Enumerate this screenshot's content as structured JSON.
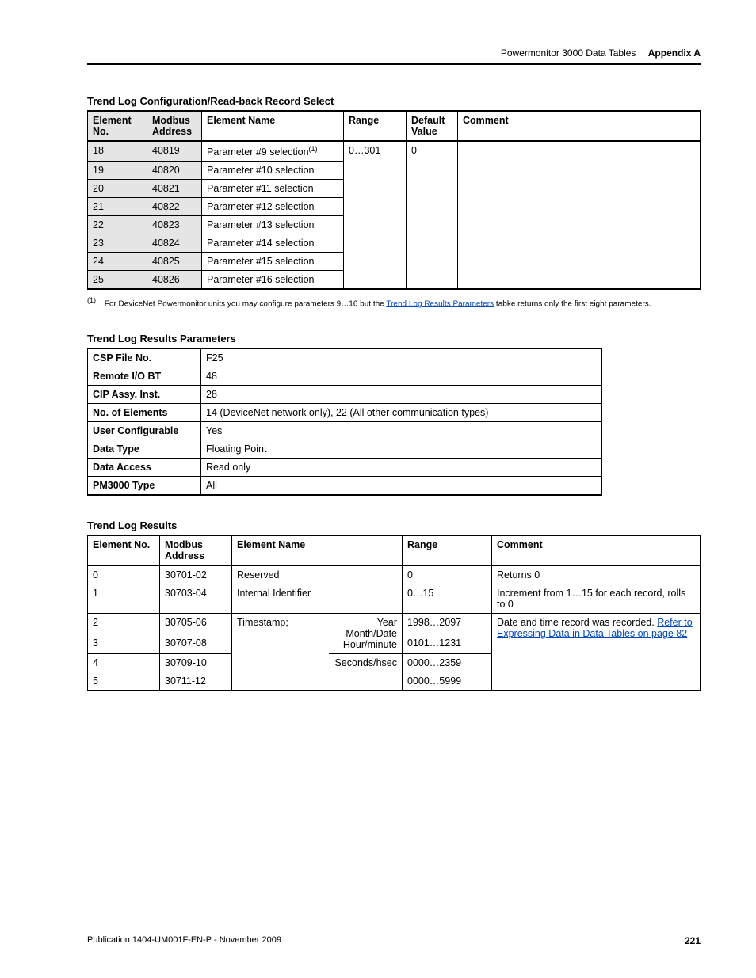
{
  "header": {
    "section": "Powermonitor 3000 Data Tables",
    "appendix": "Appendix A"
  },
  "table1": {
    "title": "Trend Log Configuration/Read-back Record Select",
    "headers": {
      "element_no": "Element No.",
      "modbus": "Modbus Address",
      "name": "Element Name",
      "range": "Range",
      "default": "Default Value",
      "comment": "Comment"
    },
    "range_val": "0…301",
    "default_val": "0",
    "rows": [
      {
        "no": "18",
        "mb": "40819",
        "name": "Parameter #9 selection",
        "sup": "(1)"
      },
      {
        "no": "19",
        "mb": "40820",
        "name": "Parameter #10 selection"
      },
      {
        "no": "20",
        "mb": "40821",
        "name": "Parameter #11 selection"
      },
      {
        "no": "21",
        "mb": "40822",
        "name": "Parameter #12 selection"
      },
      {
        "no": "22",
        "mb": "40823",
        "name": "Parameter #13 selection"
      },
      {
        "no": "23",
        "mb": "40824",
        "name": "Parameter #14 selection"
      },
      {
        "no": "24",
        "mb": "40825",
        "name": "Parameter #15 selection"
      },
      {
        "no": "25",
        "mb": "40826",
        "name": "Parameter #16 selection"
      }
    ],
    "footnote": {
      "marker": "(1)",
      "pre": "For DeviceNet Powermonitor units you may configure parameters 9…16 but the ",
      "link": "Trend Log Results Parameters",
      "post": " tabke returns only the first eight parameters."
    }
  },
  "table2": {
    "title": "Trend Log Results Parameters",
    "rows": [
      {
        "k": "CSP File No.",
        "v": "F25"
      },
      {
        "k": "Remote I/O BT",
        "v": "48"
      },
      {
        "k": "CIP Assy. Inst.",
        "v": "28"
      },
      {
        "k": "No. of Elements",
        "v": "14 (DeviceNet network only), 22 (All other communication types)"
      },
      {
        "k": "User Configurable",
        "v": "Yes"
      },
      {
        "k": "Data Type",
        "v": "Floating Point"
      },
      {
        "k": "Data Access",
        "v": "Read only"
      },
      {
        "k": "PM3000 Type",
        "v": "All"
      }
    ]
  },
  "table3": {
    "title": "Trend Log Results",
    "headers": {
      "element_no": "Element No.",
      "modbus": "Modbus Address",
      "name": "Element Name",
      "range": "Range",
      "comment": "Comment"
    },
    "timestamp_label": "Timestamp;",
    "comment_merged_pre": "Date and time record was recorded. ",
    "comment_merged_link": "Refer to Expressing Data in Data Tables on page 82",
    "rows": [
      {
        "no": "0",
        "mb": "30701-02",
        "name": "Reserved",
        "range": "0",
        "comment": "Returns 0"
      },
      {
        "no": "1",
        "mb": "30703-04",
        "name": "Internal Identifier",
        "range": "0…15",
        "comment": "Increment from 1…15 for each record, rolls to 0"
      },
      {
        "no": "2",
        "mb": "30705-06",
        "sub": "Year",
        "range": "1998…2097"
      },
      {
        "no": "3",
        "mb": "30707-08",
        "sub": "Month/Date Hour/minute",
        "range": "0101…1231"
      },
      {
        "no": "4",
        "mb": "30709-10",
        "sub": "Seconds/hsec",
        "range": "0000…2359"
      },
      {
        "no": "5",
        "mb": "30711-12",
        "sub": "",
        "range": "0000…5999"
      }
    ]
  },
  "footer": {
    "pub": "Publication 1404-UM001F-EN-P - November 2009",
    "page": "221"
  }
}
